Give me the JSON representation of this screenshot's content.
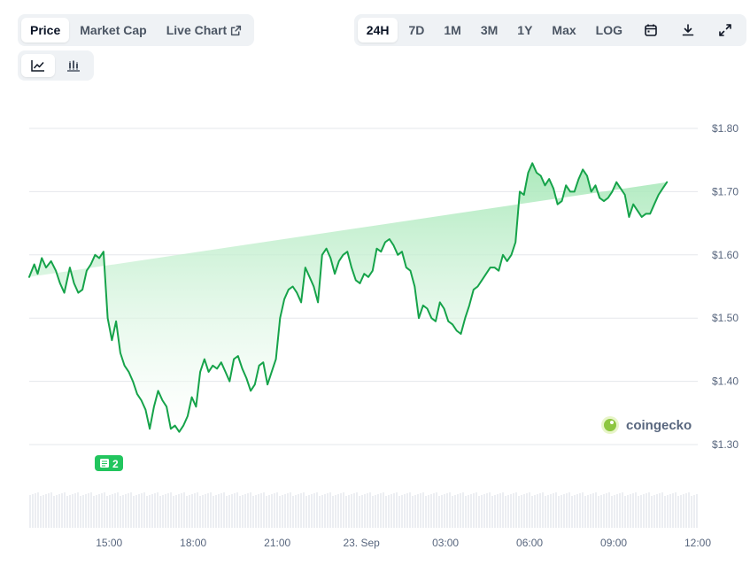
{
  "tabs_left": [
    {
      "label": "Price",
      "active": true
    },
    {
      "label": "Market Cap",
      "active": false
    },
    {
      "label": "Live Chart",
      "active": false,
      "icon": "external-link-icon"
    }
  ],
  "tabs_right": [
    {
      "label": "24H",
      "active": true
    },
    {
      "label": "7D",
      "active": false
    },
    {
      "label": "1M",
      "active": false
    },
    {
      "label": "3M",
      "active": false
    },
    {
      "label": "1Y",
      "active": false
    },
    {
      "label": "Max",
      "active": false
    },
    {
      "label": "LOG",
      "active": false
    }
  ],
  "tool_icons": [
    "calendar-icon",
    "download-icon",
    "expand-icon"
  ],
  "view_toggle": [
    "line-chart-icon",
    "candlestick-icon"
  ],
  "watermark": "coingecko",
  "news_badge": {
    "count": "2",
    "color": "#22c55e"
  },
  "colors": {
    "line": "#16a34a",
    "fill_top": "#bbf0c8",
    "grid": "#e5e7eb",
    "accent": "#22c55e"
  },
  "chart_data": {
    "type": "area",
    "y_tick_labels": [
      "$1.80",
      "$1.70",
      "$1.60",
      "$1.50",
      "$1.40",
      "$1.30"
    ],
    "y_ticks": [
      1.8,
      1.7,
      1.6,
      1.5,
      1.4,
      1.3
    ],
    "ylim": [
      1.3,
      1.8
    ],
    "x_tick_labels": [
      "15:00",
      "18:00",
      "21:00",
      "23. Sep",
      "03:00",
      "06:00",
      "09:00",
      "12:00"
    ],
    "x_ticks": [
      2.85,
      5.85,
      8.85,
      11.85,
      14.85,
      17.85,
      20.85,
      23.85
    ],
    "xlim": [
      0,
      23.85
    ],
    "grid": true,
    "x": [
      0,
      0.18,
      0.3,
      0.45,
      0.6,
      0.78,
      0.95,
      1.1,
      1.25,
      1.45,
      1.6,
      1.75,
      1.9,
      2.05,
      2.2,
      2.35,
      2.5,
      2.65,
      2.8,
      2.95,
      3.1,
      3.25,
      3.4,
      3.55,
      3.7,
      3.85,
      4.0,
      4.15,
      4.3,
      4.45,
      4.6,
      4.75,
      4.9,
      5.05,
      5.2,
      5.35,
      5.5,
      5.65,
      5.8,
      5.95,
      6.1,
      6.25,
      6.4,
      6.55,
      6.7,
      6.85,
      7.0,
      7.15,
      7.3,
      7.45,
      7.6,
      7.75,
      7.9,
      8.05,
      8.2,
      8.35,
      8.5,
      8.65,
      8.8,
      8.95,
      9.1,
      9.25,
      9.4,
      9.55,
      9.7,
      9.85,
      10.0,
      10.15,
      10.3,
      10.45,
      10.6,
      10.75,
      10.9,
      11.05,
      11.2,
      11.35,
      11.5,
      11.65,
      11.8,
      11.95,
      12.1,
      12.25,
      12.4,
      12.55,
      12.7,
      12.85,
      13.0,
      13.15,
      13.3,
      13.45,
      13.6,
      13.75,
      13.9,
      14.05,
      14.2,
      14.35,
      14.5,
      14.65,
      14.8,
      14.95,
      15.1,
      15.25,
      15.4,
      15.55,
      15.7,
      15.85,
      16.0,
      16.15,
      16.3,
      16.45,
      16.6,
      16.75,
      16.9,
      17.05,
      17.2,
      17.35,
      17.5,
      17.65,
      17.8,
      17.95,
      18.1,
      18.25,
      18.4,
      18.55,
      18.7,
      18.85,
      19.0,
      19.15,
      19.3,
      19.45,
      19.6,
      19.75,
      19.9,
      20.05,
      20.2,
      20.35,
      20.5,
      20.65,
      20.8,
      20.95,
      21.1,
      21.25,
      21.4,
      21.55,
      21.7,
      21.85,
      22.0,
      22.15,
      22.3,
      22.45,
      22.6,
      22.75,
      22.9,
      23.05,
      23.2,
      23.35,
      23.5,
      23.65,
      23.85
    ],
    "y": [
      1.565,
      1.585,
      1.57,
      1.595,
      1.58,
      1.59,
      1.575,
      1.555,
      1.54,
      1.58,
      1.555,
      1.54,
      1.545,
      1.575,
      1.585,
      1.6,
      1.595,
      1.605,
      1.5,
      1.465,
      1.495,
      1.445,
      1.425,
      1.415,
      1.4,
      1.38,
      1.37,
      1.355,
      1.325,
      1.36,
      1.385,
      1.37,
      1.36,
      1.325,
      1.33,
      1.32,
      1.33,
      1.345,
      1.375,
      1.36,
      1.415,
      1.435,
      1.415,
      1.425,
      1.42,
      1.43,
      1.415,
      1.4,
      1.435,
      1.44,
      1.42,
      1.405,
      1.385,
      1.395,
      1.425,
      1.43,
      1.395,
      1.415,
      1.435,
      1.5,
      1.53,
      1.545,
      1.55,
      1.54,
      1.525,
      1.58,
      1.565,
      1.55,
      1.525,
      1.6,
      1.61,
      1.595,
      1.57,
      1.59,
      1.6,
      1.605,
      1.58,
      1.56,
      1.555,
      1.57,
      1.565,
      1.575,
      1.61,
      1.605,
      1.62,
      1.625,
      1.615,
      1.6,
      1.605,
      1.58,
      1.575,
      1.55,
      1.5,
      1.52,
      1.515,
      1.5,
      1.495,
      1.525,
      1.515,
      1.495,
      1.49,
      1.48,
      1.475,
      1.5,
      1.52,
      1.545,
      1.55,
      1.56,
      1.57,
      1.58,
      1.58,
      1.575,
      1.6,
      1.59,
      1.6,
      1.62,
      1.7,
      1.695,
      1.73,
      1.745,
      1.73,
      1.725,
      1.71,
      1.72,
      1.705,
      1.68,
      1.685,
      1.71,
      1.7,
      1.7,
      1.72,
      1.735,
      1.725,
      1.7,
      1.71,
      1.69,
      1.685,
      1.69,
      1.7,
      1.715,
      1.705,
      1.695,
      1.66,
      1.68,
      1.67,
      1.66,
      1.665,
      1.665,
      1.68,
      1.695,
      1.705,
      1.715
    ]
  }
}
